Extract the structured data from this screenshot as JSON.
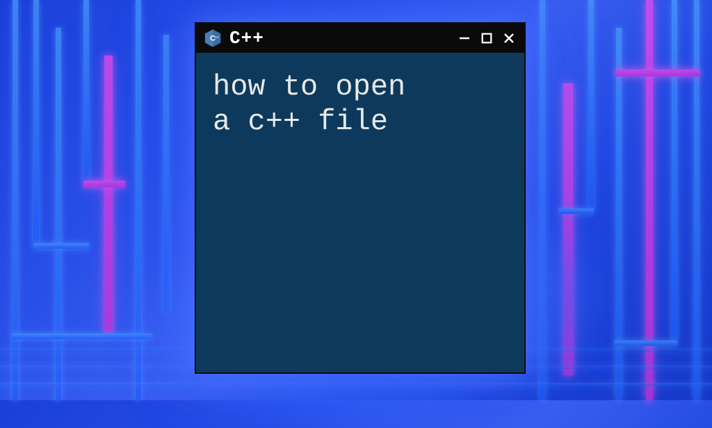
{
  "window": {
    "title": "C++",
    "icon": "cpp-icon",
    "body_line1": "how to open",
    "body_line2": "a c++ file"
  },
  "colors": {
    "window_bg": "#0d3a5c",
    "titlebar_bg": "#0a0a0a",
    "text": "#e8e8e8",
    "icon_bg": "#5a8fc7"
  }
}
